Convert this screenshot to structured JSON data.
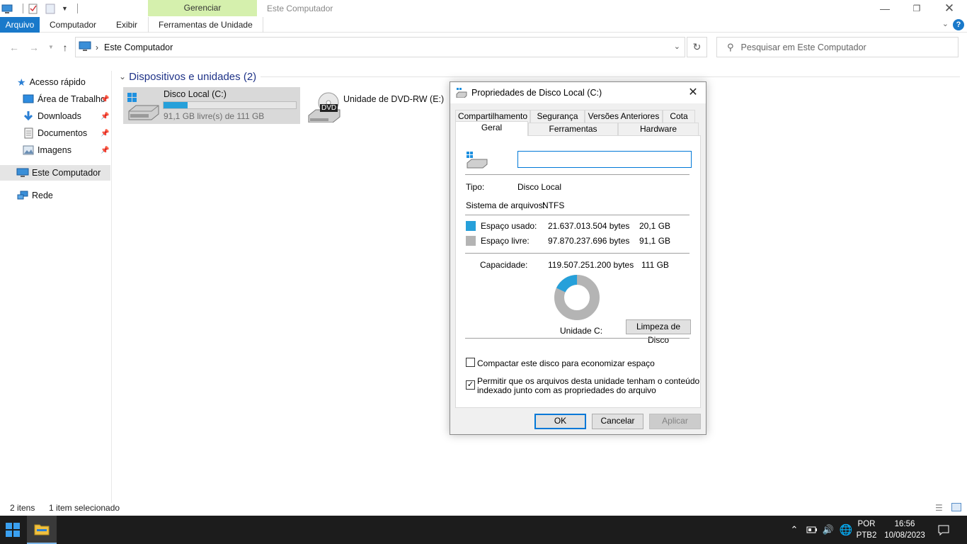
{
  "window": {
    "title": "Este Computador",
    "context_tab": "Gerenciar"
  },
  "ribbon": {
    "tabs": [
      "Arquivo",
      "Computador",
      "Exibir",
      "Ferramentas de Unidade"
    ],
    "help": "?"
  },
  "address": {
    "path": "Este Computador",
    "search_placeholder": "Pesquisar em Este Computador"
  },
  "sidebar": {
    "quick_access": "Acesso rápido",
    "pinned": [
      "Área de Trabalho",
      "Downloads",
      "Documentos",
      "Imagens"
    ],
    "this_pc": "Este Computador",
    "network": "Rede"
  },
  "content": {
    "group_header": "Dispositivos e unidades (2)",
    "drive_c": {
      "name": "Disco Local (C:)",
      "free": "91,1 GB livre(s) de 111 GB",
      "used_fraction": 0.18
    },
    "drive_e": {
      "name": "Unidade de DVD-RW (E:)",
      "badge": "DVD"
    }
  },
  "status": {
    "count": "2 itens",
    "selection": "1 item selecionado"
  },
  "dialog": {
    "title": "Propriedades de Disco Local (C:)",
    "tabs_row1": [
      "Compartilhamento",
      "Segurança",
      "Versões Anteriores",
      "Cota"
    ],
    "tabs_row2": [
      "Geral",
      "Ferramentas",
      "Hardware"
    ],
    "name_value": "",
    "type_label": "Tipo:",
    "type_value": "Disco Local",
    "fs_label": "Sistema de arquivos:",
    "fs_value": "NTFS",
    "used_label": "Espaço usado:",
    "used_bytes": "21.637.013.504 bytes",
    "used_gb": "20,1 GB",
    "free_label": "Espaço livre:",
    "free_bytes": "97.870.237.696 bytes",
    "free_gb": "91,1 GB",
    "cap_label": "Capacidade:",
    "cap_bytes": "119.507.251.200 bytes",
    "cap_gb": "111 GB",
    "drive_label": "Unidade C:",
    "used_fraction": 0.181,
    "cleanup_button": "Limpeza de Disco",
    "compress_label": "Compactar este disco para economizar espaço",
    "compress_checked": false,
    "index_label_1": "Permitir que os arquivos desta unidade tenham o conteúdo",
    "index_label_2": "indexado junto com as propriedades do arquivo",
    "index_checked": true,
    "ok": "OK",
    "cancel": "Cancelar",
    "apply": "Aplicar",
    "colors": {
      "used": "#26a0da",
      "free": "#b4b4b4"
    }
  },
  "taskbar": {
    "lang_top": "POR",
    "lang_bottom": "PTB2",
    "time": "16:56",
    "date": "10/08/2023"
  }
}
